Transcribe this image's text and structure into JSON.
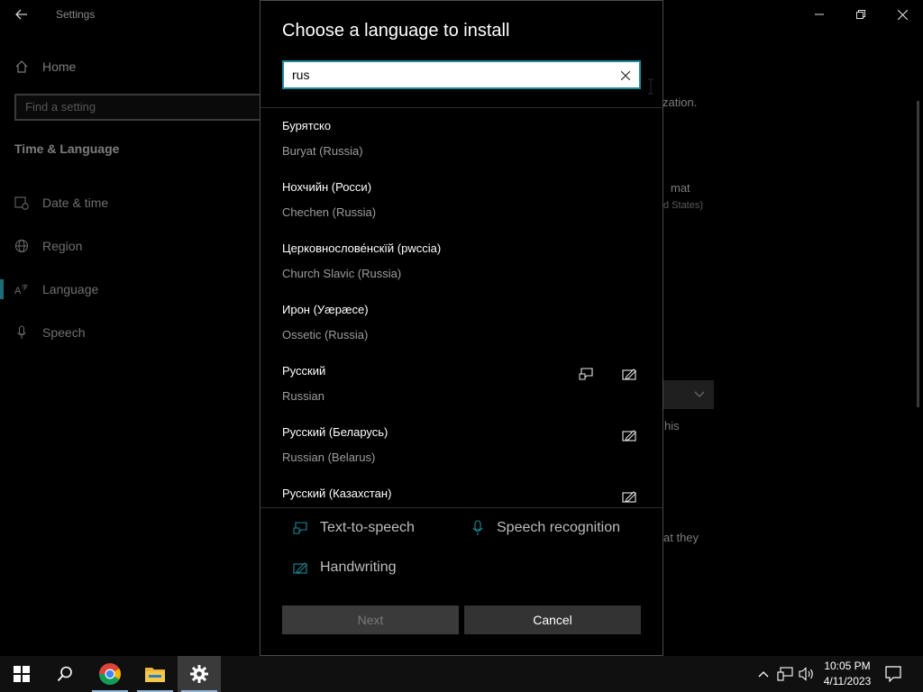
{
  "settings": {
    "title": "Settings",
    "home_label": "Home",
    "search_placeholder": "Find a setting",
    "section_title": "Time & Language",
    "nav": [
      {
        "label": "Date & time",
        "icon": "calendar-clock-icon"
      },
      {
        "label": "Region",
        "icon": "globe-icon"
      },
      {
        "label": "Language",
        "icon": "language-icon"
      },
      {
        "label": "Speech",
        "icon": "microphone-icon"
      }
    ],
    "active_nav": "Language",
    "background_fragments": [
      "zation.",
      "mat",
      "d States)",
      "his",
      "at they"
    ]
  },
  "dialog": {
    "title": "Choose a language to install",
    "search_value": "rus",
    "languages": [
      {
        "native": "Бурятско",
        "english": "Buryat (Russia)",
        "tts": false,
        "handwriting": false
      },
      {
        "native": "Нохчийн (Росси)",
        "english": "Chechen (Russia)",
        "tts": false,
        "handwriting": false
      },
      {
        "native": "Церковнослове́нскїй (рwссіа)",
        "english": "Church Slavic (Russia)",
        "tts": false,
        "handwriting": false
      },
      {
        "native": "Ирон (Уæрæсе)",
        "english": "Ossetic (Russia)",
        "tts": false,
        "handwriting": false
      },
      {
        "native": "Русский",
        "english": "Russian",
        "tts": true,
        "handwriting": true
      },
      {
        "native": "Русский (Беларусь)",
        "english": "Russian (Belarus)",
        "tts": false,
        "handwriting": true
      },
      {
        "native": "Русский (Казахстан)",
        "english": "",
        "tts": false,
        "handwriting": true
      }
    ],
    "legend": {
      "tts": "Text-to-speech",
      "speech": "Speech recognition",
      "handwriting": "Handwriting"
    },
    "next_label": "Next",
    "cancel_label": "Cancel"
  },
  "taskbar": {
    "apps": [
      "windows-start-icon",
      "search-icon",
      "chrome-icon",
      "file-explorer-icon",
      "settings-gear-icon"
    ],
    "time": "10:05 PM",
    "date": "4/11/2023"
  },
  "colors": {
    "accent": "#1f8a9a",
    "dialog_bg": "#000000",
    "button_disabled": "#3a3a3a",
    "button_cancel": "#333333"
  }
}
